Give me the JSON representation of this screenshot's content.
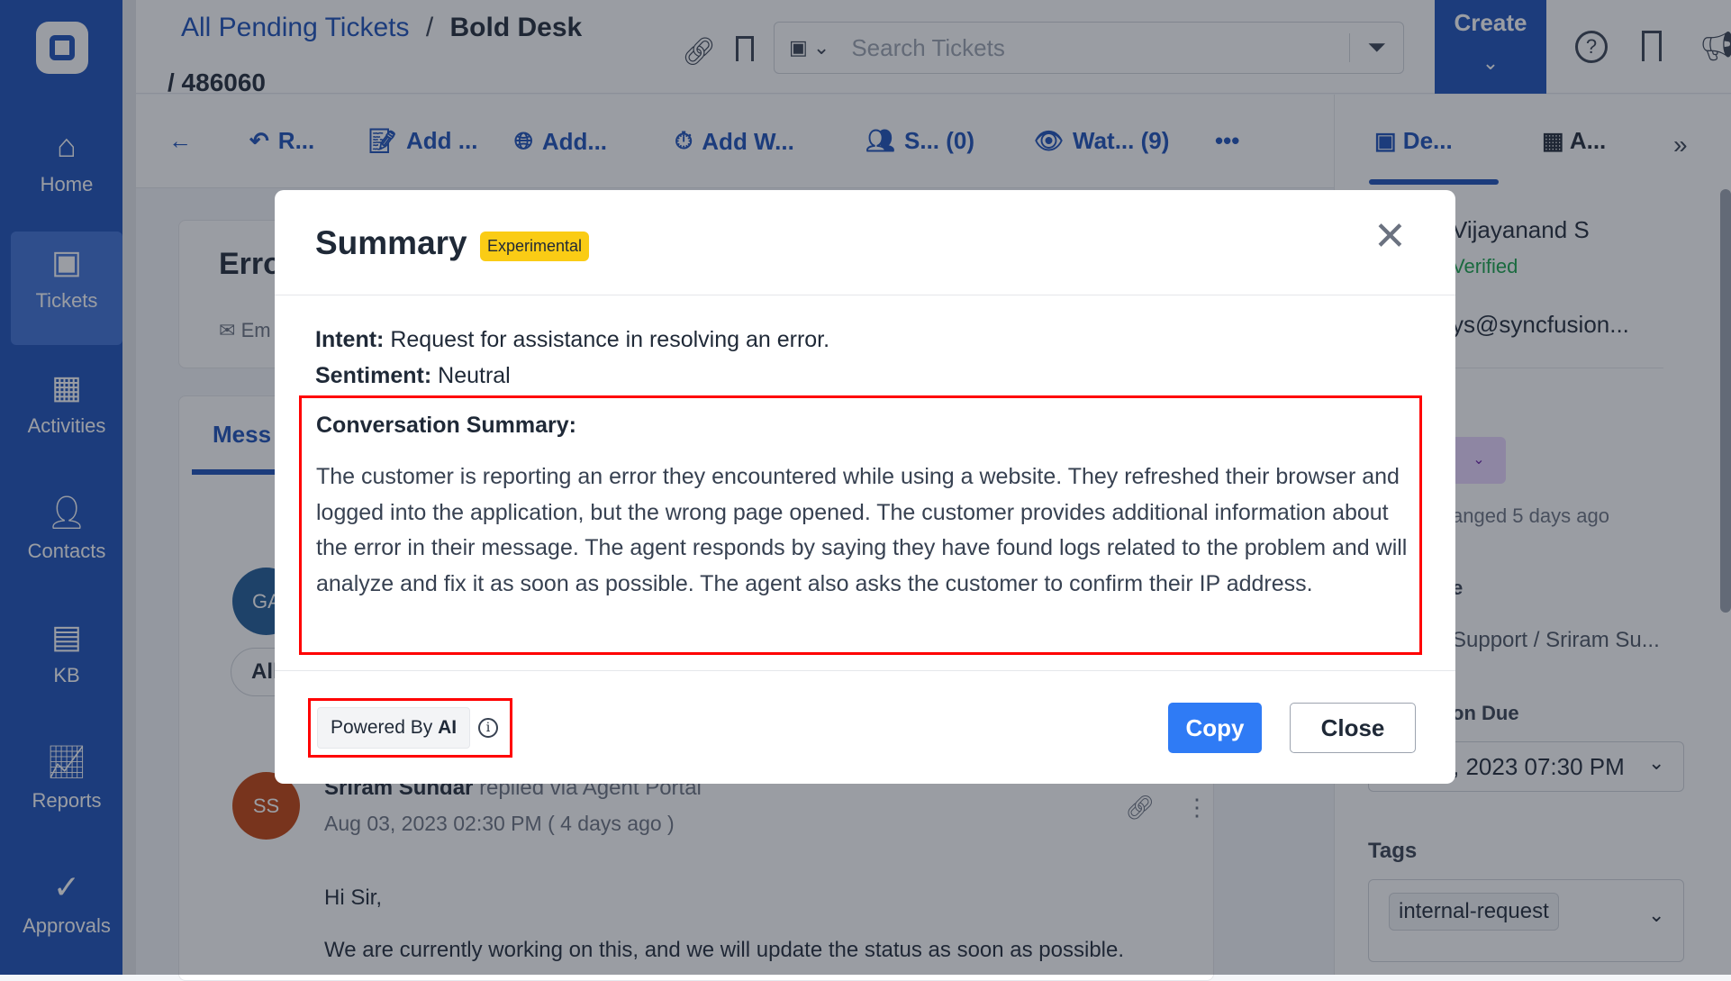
{
  "sidebar": {
    "items": [
      {
        "label": "Home",
        "icon": "home-icon"
      },
      {
        "label": "Tickets",
        "icon": "ticket-icon",
        "selected": true
      },
      {
        "label": "Activities",
        "icon": "calendar-check-icon"
      },
      {
        "label": "Contacts",
        "icon": "person-icon"
      },
      {
        "label": "KB",
        "icon": "book-icon"
      },
      {
        "label": "Reports",
        "icon": "chart-line-icon"
      },
      {
        "label": "Approvals",
        "icon": "check-circle-icon"
      }
    ]
  },
  "header": {
    "breadcrumb_link": "All Pending Tickets",
    "breadcrumb_sep": "/",
    "breadcrumb_current": "Bold Desk",
    "ticket_id": "/ 486060",
    "search_placeholder": "Search Tickets",
    "create_label": "Create"
  },
  "toolbar": {
    "items": [
      "R...",
      "Add ...",
      "Add...",
      "Add W...",
      "S...  (0)",
      "Wat...  (9)"
    ],
    "more": "•••"
  },
  "right_tabs": {
    "details": "De...",
    "apps": "A..."
  },
  "background": {
    "ticket_title": "Erro",
    "email_label": "Em",
    "messages_tab": "Mess",
    "filter_all": "All",
    "avatar_ga": "GA",
    "avatar_ss": "SS",
    "author": "Sriram Sundar",
    "via": "replied via Agent Portal",
    "date": "Aug 03, 2023 02:30 PM ( 4 days ago )",
    "greeting": "Hi Sir,",
    "body": "We are currently working on this, and we will update the status as soon as possible."
  },
  "right_panel": {
    "name": "Vijayanand S",
    "verified": "Verified",
    "email": "ys@syncfusion...",
    "changed": "anged 5 days ago",
    "group_label": "e",
    "group_value": "Support / Sriram Su...",
    "due_label": "on Due",
    "due_value": ", 2023 07:30 PM",
    "tags_label": "Tags",
    "tag": "internal-request"
  },
  "modal": {
    "title": "Summary",
    "badge": "Experimental",
    "intent_label": "Intent:",
    "intent_value": "Request for assistance in resolving an error.",
    "sentiment_label": "Sentiment:",
    "sentiment_value": "Neutral",
    "summary_heading": "Conversation Summary:",
    "summary_text": "The customer is reporting an error they encountered while using a website. They refreshed their browser and logged into the application, but the wrong page opened. The customer provides additional information about the error in their message. The agent responds by saying they have found logs related to the problem and will analyze and fix it as soon as possible. The agent also asks the customer to confirm their IP address.",
    "powered_by": "Powered By",
    "powered_ai": "AI",
    "copy_label": "Copy",
    "close_label": "Close"
  },
  "colors": {
    "primary": "#1a4fb8",
    "button_blue": "#2f7bf5",
    "badge": "#facc15",
    "highlight": "#ff0000",
    "verified": "#16a34a"
  }
}
